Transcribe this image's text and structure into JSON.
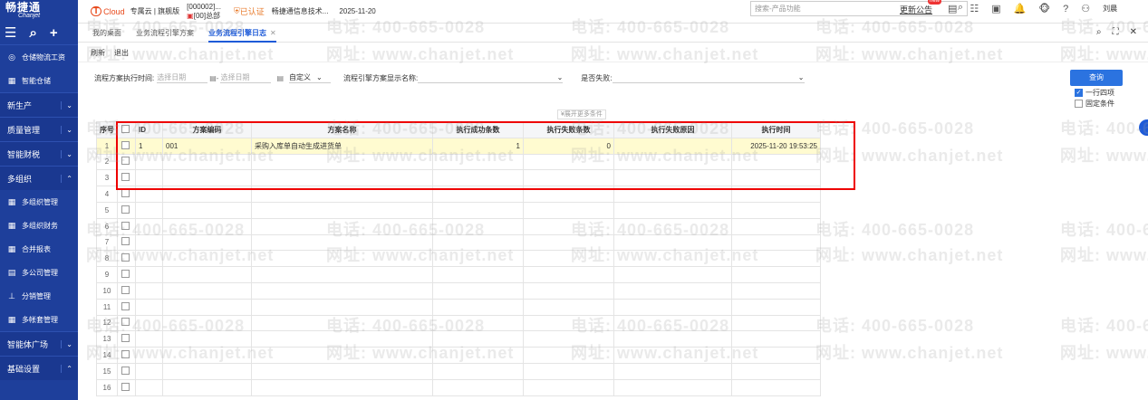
{
  "sidebar": {
    "logo": "畅捷通",
    "logo_sub": "Chanjet",
    "items_top": [
      {
        "label": "仓储物流工资",
        "icon": "storage-icon"
      },
      {
        "label": "智能仓储",
        "icon": "warehouse-icon"
      }
    ],
    "groups": [
      {
        "label": "新生产"
      },
      {
        "label": "质量管理"
      },
      {
        "label": "智能财税"
      },
      {
        "label": "多组织",
        "expanded": true
      }
    ],
    "org_items": [
      {
        "label": "多组织管理"
      },
      {
        "label": "多组织财务"
      },
      {
        "label": "合并报表"
      },
      {
        "label": "多公司管理"
      },
      {
        "label": "分销管理"
      },
      {
        "label": "多帐套管理"
      }
    ],
    "groups_bottom": [
      {
        "label": "智能体广场"
      },
      {
        "label": "基础设置"
      }
    ]
  },
  "topbar": {
    "cloud": "Cloud",
    "edition": "专属云 | 旗舰版",
    "org_line1": "[000002]...",
    "org_line2": "[00]总部",
    "certified": "已认证",
    "company": "畅捷通信息技术...",
    "date": "2025-11-20",
    "search_placeholder": "搜索-产品功能",
    "announce": "更新公告",
    "badge": "new",
    "user": "刘晨"
  },
  "tabs": [
    {
      "label": "我的桌面"
    },
    {
      "label": "业务流程引擎方案"
    },
    {
      "label": "业务流程引擎日志",
      "active": true
    }
  ],
  "toolbar": {
    "refresh": "刷新",
    "exit": "退出"
  },
  "filter": {
    "exec_time_label": "流程方案执行时间:",
    "start_ph": "选择日期",
    "end_ph": "选择日期",
    "custom": "自定义",
    "scheme_name_label": "流程引擎方案显示名称:",
    "failed_label": "是否失败:",
    "query": "查询",
    "one_row_four": "一行四项",
    "fixed_cond": "固定条件",
    "expand_more": "展开更多条件"
  },
  "grid": {
    "headers": [
      "序号",
      "",
      "ID",
      "方案编码",
      "方案名称",
      "执行成功条数",
      "执行失败条数",
      "执行失败原因",
      "执行时间"
    ],
    "rows": [
      {
        "seq": "1",
        "id": "1",
        "code": "001",
        "name": "采购入库单自动生成进货单",
        "success": "1",
        "fail": "0",
        "reason": "",
        "time": "2025-11-20 19:53:25"
      }
    ],
    "empty_rows": [
      "2",
      "3",
      "4",
      "5",
      "6",
      "7",
      "8",
      "9",
      "10",
      "11",
      "12",
      "13",
      "14",
      "15",
      "16"
    ]
  },
  "watermark": {
    "phone": "电话: 400-665-0028",
    "site": "网址: www.chanjet.net"
  }
}
